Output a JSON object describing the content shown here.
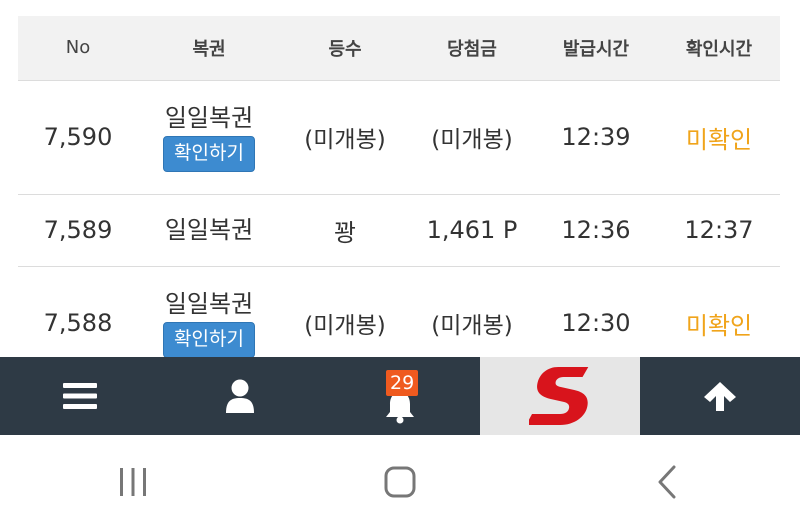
{
  "table": {
    "headers": {
      "no": "No",
      "ticket": "복권",
      "rank": "등수",
      "prize": "당첨금",
      "issued_time": "발급시간",
      "confirm_time": "확인시간"
    },
    "rows": [
      {
        "no": "7,590",
        "ticket": "일일복권",
        "confirm_button": "확인하기",
        "rank": "(미개봉)",
        "prize": "(미개봉)",
        "issued_time": "12:39",
        "confirm_time": "미확인"
      },
      {
        "no": "7,589",
        "ticket": "일일복권",
        "rank": "꽝",
        "prize": "1,461 P",
        "issued_time": "12:36",
        "confirm_time": "12:37"
      },
      {
        "no": "7,588",
        "ticket": "일일복권",
        "confirm_button": "확인하기",
        "rank": "(미개봉)",
        "prize": "(미개봉)",
        "issued_time": "12:30",
        "confirm_time": "미확인"
      }
    ]
  },
  "bottom_nav": {
    "menu_icon": "hamburger-menu-icon",
    "user_icon": "user-icon",
    "bell_icon": "bell-icon",
    "notification_count": "29",
    "brand_logo": "red-s-logo",
    "top_icon": "arrow-up-icon"
  },
  "system_nav": {
    "recents_icon": "recents-icon",
    "home_icon": "home-icon",
    "back_icon": "back-icon"
  },
  "colors": {
    "header_bg": "#f2f2f2",
    "button_blue": "#3d8bd0",
    "unconfirmed_orange": "#f0a41b",
    "nav_bg": "#2e3a45",
    "badge_orange": "#ef5a1f",
    "logo_red": "#d8141c"
  }
}
